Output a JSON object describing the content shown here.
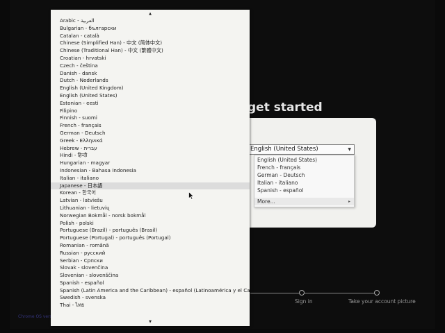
{
  "welcome": {
    "title": "get started",
    "language_select": {
      "value": "English (United States)"
    },
    "dropdown": {
      "options": [
        "English (United States)",
        "French - français",
        "German - Deutsch",
        "Italian - italiano",
        "Spanish - español"
      ],
      "more_label": "More..."
    }
  },
  "progress": {
    "steps": [
      {
        "label": "Sign in"
      },
      {
        "label": "Take your account picture"
      }
    ]
  },
  "footer": {
    "version": "Chrome OS versi"
  },
  "language_menu": {
    "selected_index": 22,
    "items": [
      "Arabic - العربية",
      "Bulgarian - български",
      "Catalan - català",
      "Chinese (Simplified Han) - 中文 (简体中文)",
      "Chinese (Traditional Han) - 中文 (繁體中文)",
      "Croatian - hrvatski",
      "Czech - čeština",
      "Danish - dansk",
      "Dutch - Nederlands",
      "English (United Kingdom)",
      "English (United States)",
      "Estonian - eesti",
      "Filipino",
      "Finnish - suomi",
      "French - français",
      "German - Deutsch",
      "Greek - Ελληνικά",
      "Hebrew - עברית",
      "Hindi - हिन्दी",
      "Hungarian - magyar",
      "Indonesian - Bahasa Indonesia",
      "Italian - italiano",
      "Japanese - 日本語",
      "Korean - 한국어",
      "Latvian - latviešu",
      "Lithuanian - lietuvių",
      "Norwegian Bokmål - norsk bokmål",
      "Polish - polski",
      "Portuguese (Brazil) - português (Brasil)",
      "Portuguese (Portugal) - português (Portugal)",
      "Romanian - română",
      "Russian - русский",
      "Serbian - Српски",
      "Slovak - slovenčina",
      "Slovenian - slovenščina",
      "Spanish - español",
      "Spanish (Latin America and the Caribbean) - español (Latinoamérica y el Caribe)",
      "Swedish - svenska",
      "Thai - ไทย"
    ]
  }
}
